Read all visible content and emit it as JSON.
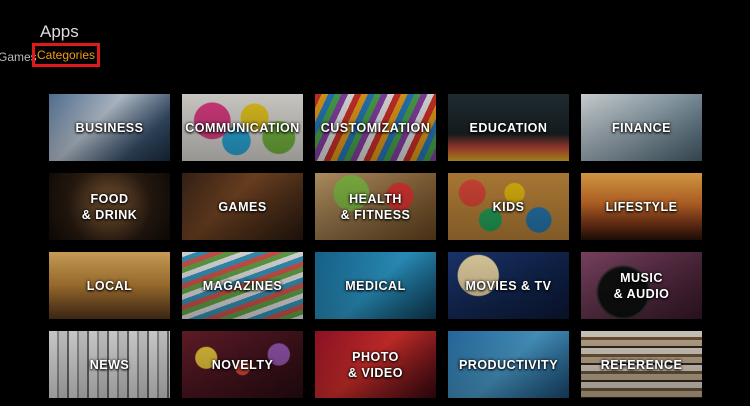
{
  "header": {
    "title": "Apps",
    "subnav": {
      "games_label": "Games",
      "categories_label": "Categories"
    }
  },
  "categories": [
    {
      "label": "BUSINESS",
      "icon": "business-tile"
    },
    {
      "label": "COMMUNICATION",
      "icon": "communication-tile"
    },
    {
      "label": "CUSTOMIZATION",
      "icon": "customization-tile"
    },
    {
      "label": "EDUCATION",
      "icon": "education-tile"
    },
    {
      "label": "FINANCE",
      "icon": "finance-tile"
    },
    {
      "label": "FOOD\n& DRINK",
      "icon": "food-drink-tile"
    },
    {
      "label": "GAMES",
      "icon": "games-tile"
    },
    {
      "label": "HEALTH\n& FITNESS",
      "icon": "health-fitness-tile"
    },
    {
      "label": "KIDS",
      "icon": "kids-tile"
    },
    {
      "label": "LIFESTYLE",
      "icon": "lifestyle-tile"
    },
    {
      "label": "LOCAL",
      "icon": "local-tile"
    },
    {
      "label": "MAGAZINES",
      "icon": "magazines-tile"
    },
    {
      "label": "MEDICAL",
      "icon": "medical-tile"
    },
    {
      "label": "MOVIES & TV",
      "icon": "movies-tv-tile"
    },
    {
      "label": "MUSIC\n& AUDIO",
      "icon": "music-audio-tile"
    },
    {
      "label": "NEWS",
      "icon": "news-tile"
    },
    {
      "label": "NOVELTY",
      "icon": "novelty-tile"
    },
    {
      "label": "PHOTO\n& VIDEO",
      "icon": "photo-video-tile"
    },
    {
      "label": "PRODUCTIVITY",
      "icon": "productivity-tile"
    },
    {
      "label": "REFERENCE",
      "icon": "reference-tile"
    }
  ],
  "colors": {
    "background": "#000000",
    "selected_tab_text": "#f39c12",
    "highlight_box": "#e01919"
  }
}
